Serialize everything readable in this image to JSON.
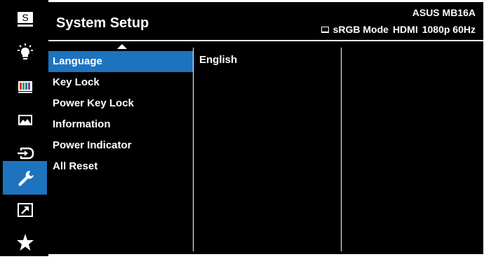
{
  "header": {
    "title": "System Setup",
    "model": "ASUS MB16A",
    "status": [
      "sRGB Mode",
      "HDMI",
      "1080p 60Hz"
    ]
  },
  "sidebar": {
    "items": [
      {
        "icon": "splendid-s-icon",
        "active": false
      },
      {
        "icon": "blue-light-icon",
        "active": false
      },
      {
        "icon": "color-bars-icon",
        "active": false
      },
      {
        "icon": "image-icon",
        "active": false
      },
      {
        "icon": "input-select-icon",
        "active": false
      },
      {
        "icon": "wrench-icon",
        "active": true
      },
      {
        "icon": "shortcut-arrow-icon",
        "active": false
      },
      {
        "icon": "star-icon",
        "active": false
      }
    ]
  },
  "menu": {
    "items": [
      "Language",
      "Key Lock",
      "Power Key Lock",
      "Information",
      "Power Indicator",
      "All Reset"
    ],
    "selected": "Language"
  },
  "value_panel": {
    "value": "English"
  },
  "colors": {
    "accent": "#1e73be",
    "background": "#000000",
    "text": "#ffffff"
  }
}
